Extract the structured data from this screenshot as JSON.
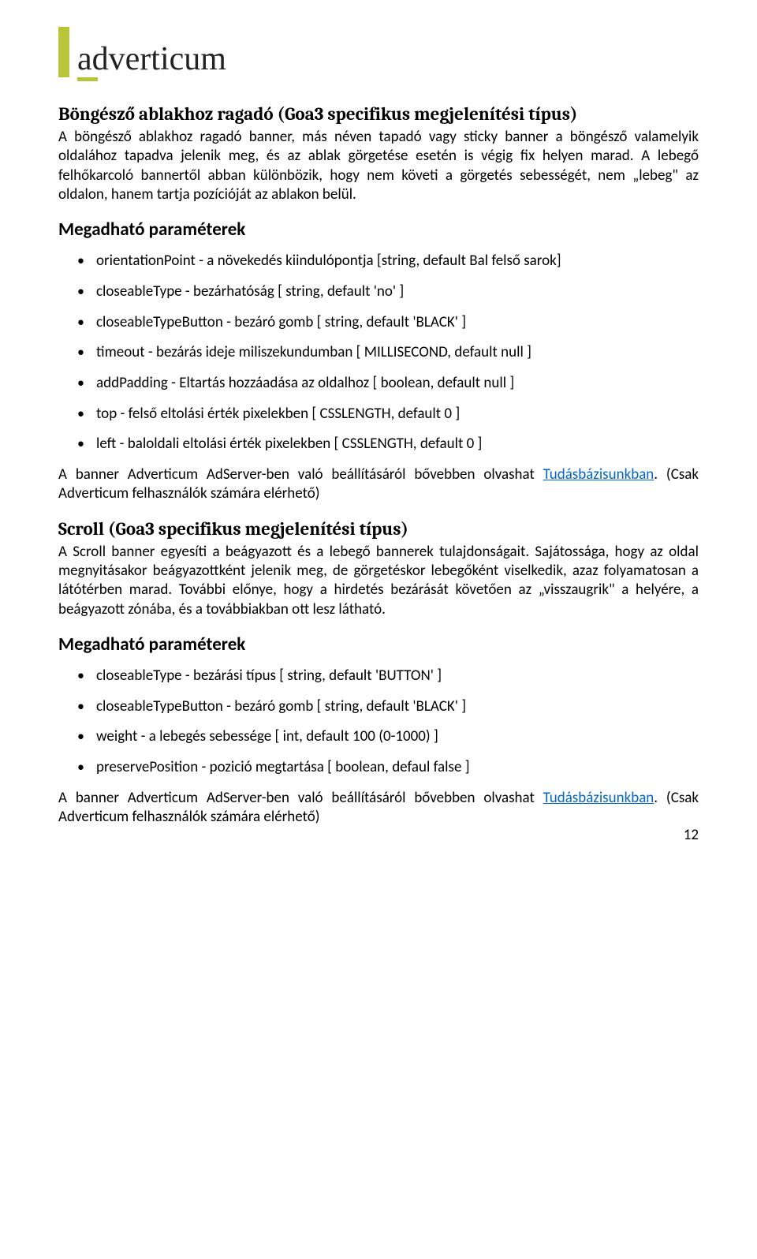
{
  "logo": {
    "text": "adverticum"
  },
  "section1": {
    "title": "Böngésző ablakhoz ragadó (Goa3 specifikus megjelenítési típus)",
    "para": "A böngésző ablakhoz ragadó banner, más néven tapadó vagy sticky banner a böngésző valamelyik oldalához tapadva jelenik meg, és az ablak görgetése esetén is végig fix helyen marad. A lebegő felhőkarcoló bannertől abban különbözik, hogy nem követi a görgetés sebességét, nem „lebeg\" az oldalon, hanem tartja pozícióját az ablakon belül.",
    "params_title": "Megadható paraméterek",
    "params": [
      "orientationPoint - a növekedés kiindulópontja [string, default Bal felső sarok]",
      "closeableType - bezárhatóság [ string, default 'no' ]",
      "closeableTypeButton - bezáró gomb [ string, default 'BLACK' ]",
      "timeout - bezárás ideje miliszekundumban [ MILLISECOND, default null ]",
      "addPadding - Eltartás hozzáadása az oldalhoz [ boolean, default null ]",
      "top - felső eltolási érték pixelekben [ CSSLENGTH, default 0 ]",
      "left - baloldali eltolási érték pixelekben [ CSSLENGTH, default 0 ]"
    ],
    "note_pre": "A banner Adverticum AdServer-ben való beállításáról bővebben olvashat ",
    "note_link": "Tudásbázisunkban",
    "note_post": ". (Csak Adverticum felhasználók számára elérhető)"
  },
  "section2": {
    "title": "Scroll (Goa3 specifikus megjelenítési típus)",
    "para": "A Scroll banner egyesíti a beágyazott és a lebegő bannerek tulajdonságait. Sajátossága, hogy az oldal megnyitásakor beágyazottként jelenik meg, de görgetéskor lebegőként viselkedik, azaz folyamatosan a látótérben marad. További előnye, hogy a hirdetés bezárását követően az „visszaugrik\" a helyére, a beágyazott zónába, és a továbbiakban ott lesz látható.",
    "params_title": "Megadható paraméterek",
    "params": [
      "closeableType - bezárási típus [ string, default 'BUTTON' ]",
      "closeableTypeButton - bezáró gomb [ string, default 'BLACK' ]",
      "weight - a lebegés sebessége [ int, default 100 (0-1000) ]",
      "preservePosition - pozició megtartása [ boolean, defaul false ]"
    ],
    "note_pre": "A banner Adverticum AdServer-ben való beállításáról bővebben olvashat ",
    "note_link": "Tudásbázisunkban",
    "note_post": ". (Csak Adverticum felhasználók számára elérhető)"
  },
  "page_number": "12"
}
